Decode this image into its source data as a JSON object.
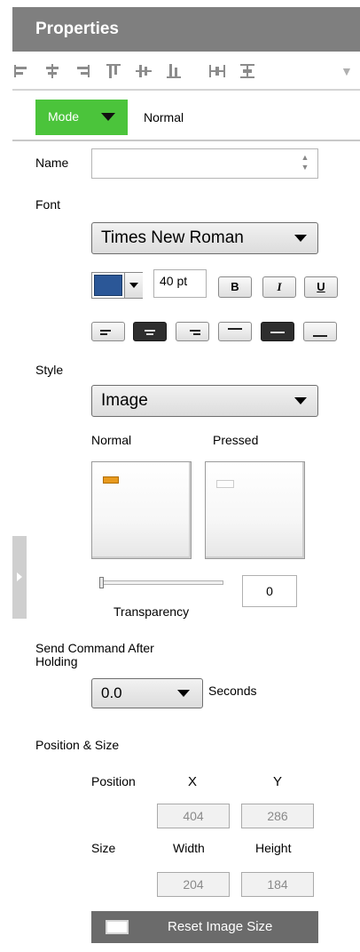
{
  "panel": {
    "title": "Properties"
  },
  "toolbar": {
    "icons": [
      "align-left-icon",
      "align-center-horizontal-icon",
      "align-right-icon",
      "align-top-icon",
      "align-middle-vertical-icon",
      "align-bottom-icon",
      "distribute-horizontal-icon",
      "distribute-vertical-icon"
    ],
    "more_icon": "chevron-down-icon"
  },
  "mode": {
    "button_label": "Mode",
    "current": "Normal"
  },
  "name": {
    "label": "Name",
    "value": ""
  },
  "font": {
    "label": "Font",
    "family": "Times New Roman",
    "size": "40 pt",
    "color": "#2b5797",
    "bold_label": "B",
    "italic_label": "I",
    "underline_label": "U",
    "alignments": [
      "align-text-left",
      "align-text-center",
      "align-text-right",
      "align-text-top",
      "align-text-middle",
      "align-text-bottom"
    ],
    "selected_alignments": [
      "align-text-center",
      "align-text-middle"
    ]
  },
  "style": {
    "label": "Style",
    "value": "Image",
    "normal_label": "Normal",
    "pressed_label": "Pressed",
    "normal_indicator_color": "#e89a1e",
    "transparency_label": "Transparency",
    "transparency_value": "0"
  },
  "hold": {
    "label": "Send Command After Holding",
    "value": "0.0",
    "unit_label": "Seconds"
  },
  "position_size": {
    "label": "Position & Size",
    "position_label": "Position",
    "size_label": "Size",
    "x_label": "X",
    "y_label": "Y",
    "width_label": "Width",
    "height_label": "Height",
    "x": "404",
    "y": "286",
    "width": "204",
    "height": "184",
    "reset_label": "Reset Image Size"
  },
  "colors": {
    "header": "#7f7f7f",
    "mode_button": "#4bc43b",
    "reset_button": "#6b6b6b"
  }
}
